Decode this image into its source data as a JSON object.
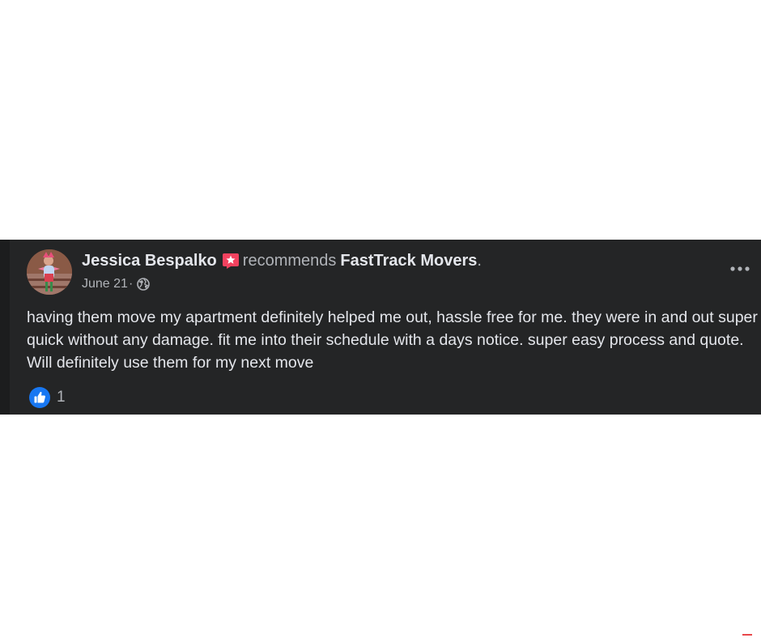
{
  "post": {
    "author": "Jessica Bespalko",
    "action": "recommends",
    "page_name": "FastTrack Movers",
    "period": ".",
    "date": "June 21",
    "separator": "·",
    "audience_icon": "globe-icon",
    "recommendation_icon": "recommend-star-icon",
    "more_icon": "more-options-icon",
    "body": "having them move my apartment definitely helped me out, hassle free for me. they were in and out super quick without any damage. fit me into their schedule with a days notice. super easy process and quote. Will definitely use them for my next move",
    "reaction_icon": "like-icon",
    "reaction_count": "1"
  },
  "colors": {
    "card_background": "#242526",
    "primary_text": "#e4e6eb",
    "secondary_text": "#b0b3b8",
    "like_blue": "#1877f2",
    "recommend_red": "#f3425f"
  }
}
